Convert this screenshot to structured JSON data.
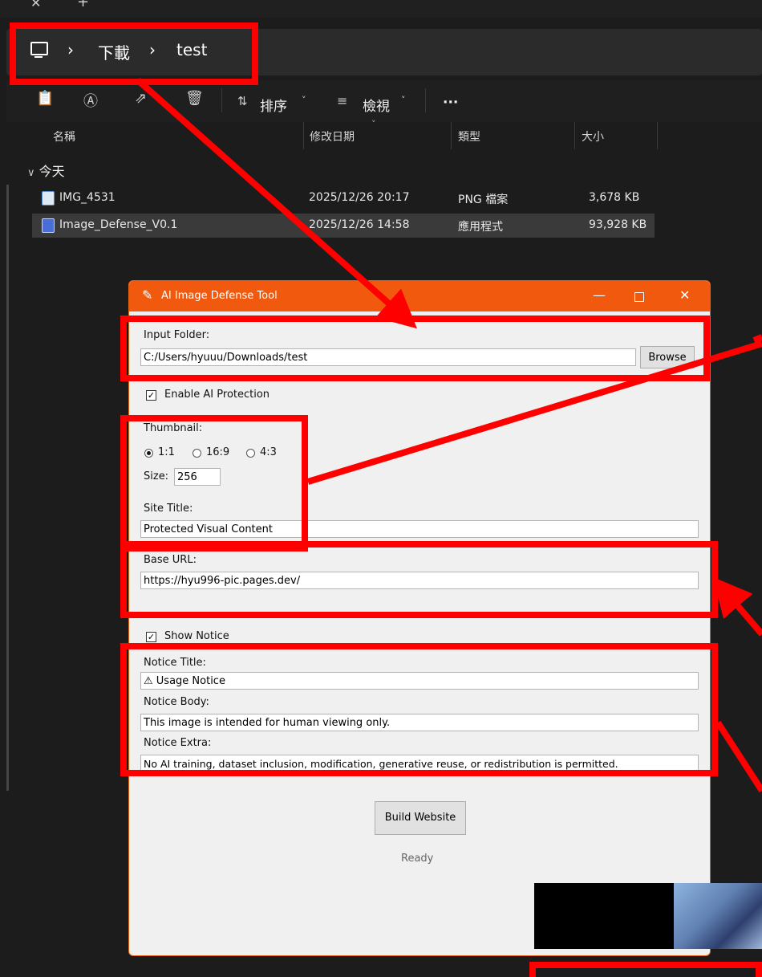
{
  "explorer": {
    "breadcrumb": [
      "下載",
      "test"
    ],
    "toolbar": {
      "sort_label": "排序",
      "view_label": "檢視",
      "more_label": "···"
    },
    "columns": [
      "名稱",
      "修改日期",
      "類型",
      "大小"
    ],
    "group_label": "今天",
    "files": [
      {
        "name": "IMG_4531",
        "modified": "2025/12/26 20:17",
        "type": "PNG 檔案",
        "size": "3,678 KB",
        "icon": "png-file-icon",
        "selected": false
      },
      {
        "name": "Image_Defense_V0.1",
        "modified": "2025/12/26 14:58",
        "type": "應用程式",
        "size": "93,928 KB",
        "icon": "application-icon",
        "selected": true
      }
    ]
  },
  "app": {
    "title": "AI Image Defense Tool",
    "input_folder": {
      "label": "Input Folder:",
      "value": "C:/Users/hyuuu/Downloads/test",
      "browse_label": "Browse"
    },
    "enable_ai_protection": {
      "label": "Enable AI Protection",
      "checked": true
    },
    "thumbnail": {
      "label": "Thumbnail:",
      "ratios": [
        {
          "label": "1:1",
          "selected": true
        },
        {
          "label": "16:9",
          "selected": false
        },
        {
          "label": "4:3",
          "selected": false
        }
      ],
      "size_label": "Size:",
      "size_value": "256"
    },
    "site_title": {
      "label": "Site Title:",
      "value": "Protected Visual Content"
    },
    "base_url": {
      "label": "Base URL:",
      "value": "https://hyu996-pic.pages.dev/"
    },
    "show_notice": {
      "label": "Show Notice",
      "checked": true
    },
    "notice_title": {
      "label": "Notice Title:",
      "value": "⚠ Usage Notice"
    },
    "notice_body": {
      "label": "Notice Body:",
      "value": "This image is intended for human viewing only."
    },
    "notice_extra": {
      "label": "Notice Extra:",
      "value": "No AI training, dataset inclusion, modification, generative reuse, or redistribution is permitted."
    },
    "build_button_label": "Build Website",
    "status_text": "Ready"
  },
  "colors": {
    "titlebar": "#f15a0e",
    "annotation": "#ff0000",
    "explorer_bg": "#1c1c1c"
  }
}
